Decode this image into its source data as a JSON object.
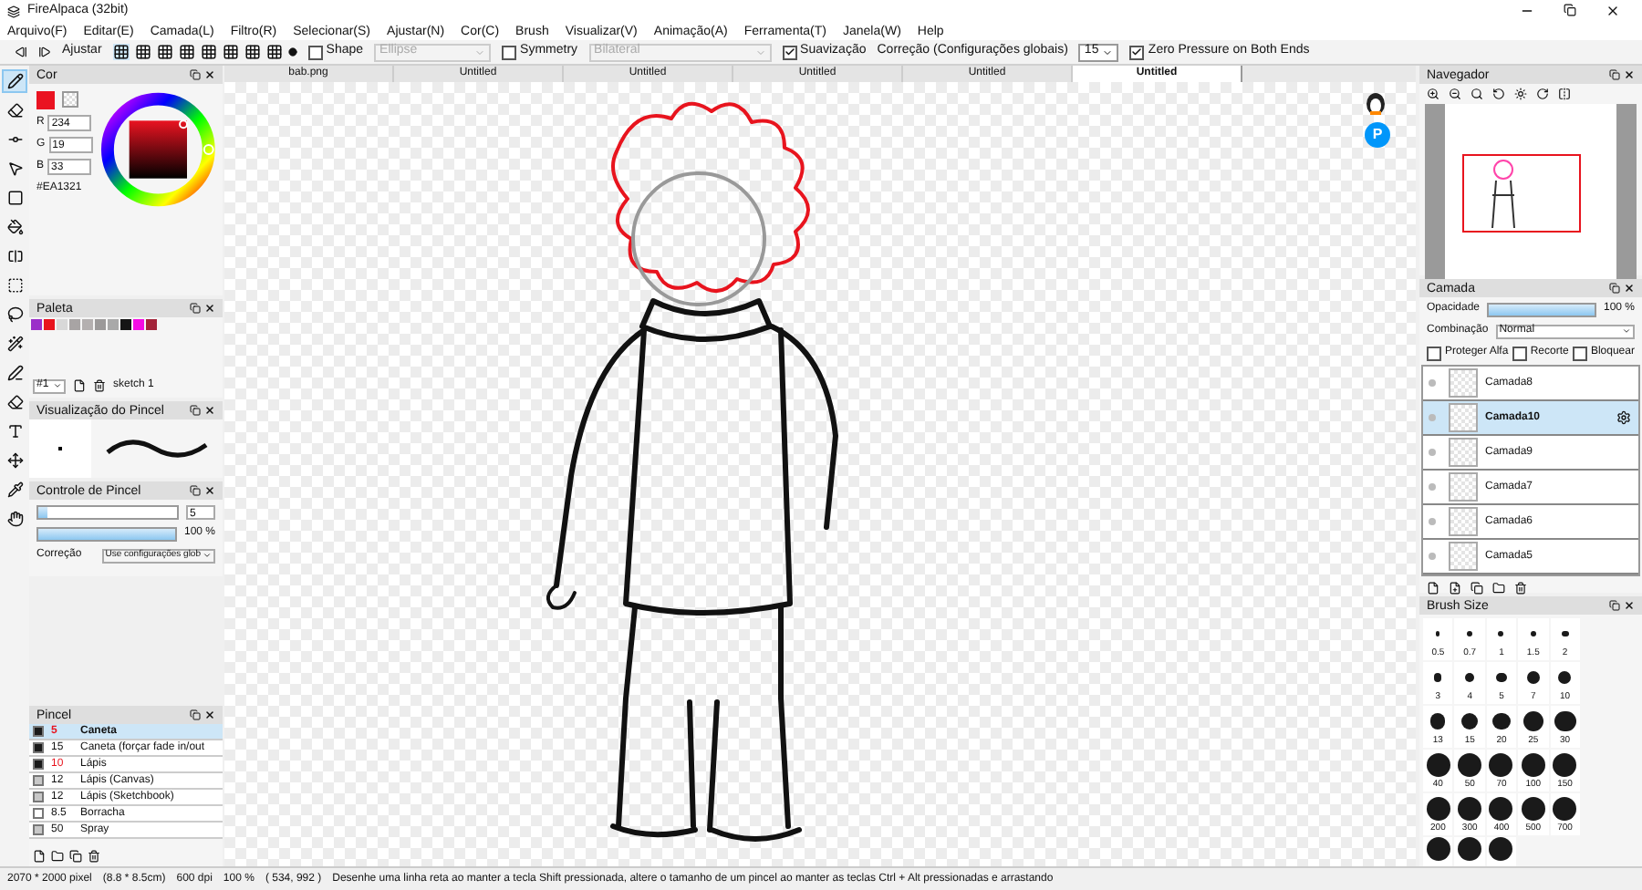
{
  "window": {
    "title": "FireAlpaca (32bit)"
  },
  "menu": [
    "Arquivo(F)",
    "Editar(E)",
    "Camada(L)",
    "Filtro(R)",
    "Selecionar(S)",
    "Ajustar(N)",
    "Cor(C)",
    "Brush",
    "Visualizar(V)",
    "Animação(A)",
    "Ferramenta(T)",
    "Janela(W)",
    "Help"
  ],
  "toolbar": {
    "snap_label": "Ajustar",
    "shape": {
      "label": "Shape",
      "checked": false,
      "value": "Ellipse"
    },
    "symmetry": {
      "label": "Symmetry",
      "checked": false,
      "value": "Bilateral"
    },
    "smoothing": {
      "label": "Suavização",
      "checked": true
    },
    "correction": {
      "label": "Correção (Configurações globais)",
      "value": "15"
    },
    "zero_pressure": {
      "label": "Zero Pressure on Both Ends",
      "checked": true
    }
  },
  "tools": [
    {
      "kind": "pen",
      "selected": true
    },
    {
      "kind": "eraser",
      "selected": false
    },
    {
      "kind": "dots",
      "selected": false
    },
    {
      "kind": "move",
      "selected": false
    },
    {
      "kind": "fill",
      "selected": false
    },
    {
      "kind": "bucket",
      "selected": false
    },
    {
      "kind": "gradient",
      "selected": false
    },
    {
      "kind": "select",
      "selected": false
    },
    {
      "kind": "lasso",
      "selected": false
    },
    {
      "kind": "wand",
      "selected": false
    },
    {
      "kind": "selpen",
      "selected": false
    },
    {
      "kind": "selerase",
      "selected": false
    },
    {
      "kind": "text",
      "selected": false
    },
    {
      "kind": "operation",
      "selected": false
    },
    {
      "kind": "dropper",
      "selected": false
    },
    {
      "kind": "hand",
      "selected": false
    }
  ],
  "color_panel": {
    "title": "Cor",
    "color": "#ea1321",
    "channels": [
      {
        "label": "R",
        "value": "234"
      },
      {
        "label": "G",
        "value": "19"
      },
      {
        "label": "B",
        "value": "33"
      }
    ],
    "hex": "#EA1321"
  },
  "palette": {
    "title": "Paleta",
    "swatches": [
      {
        "color": "#9b2fc9"
      },
      {
        "color": "#e8141e"
      },
      {
        "color": "#d8d8d8"
      },
      {
        "color": "#a8a4a4"
      },
      {
        "color": "#b4b0b0"
      },
      {
        "color": "#9c9a9a"
      },
      {
        "color": "#a9a9a9"
      },
      {
        "color": "#151515"
      },
      {
        "color": "#f40ce4"
      },
      {
        "color": "#a3243a"
      }
    ],
    "set": "#1",
    "name": "sketch 1"
  },
  "brush_preview": {
    "title": "Visualização do Pincel"
  },
  "brush_control": {
    "title": "Controle de Pincel",
    "size": {
      "level": 0.06,
      "value": "5"
    },
    "opacity": {
      "level": 1,
      "value": "100 %"
    },
    "correction_label": "Correção",
    "correction_value": "Use configurações glob"
  },
  "brushes": {
    "title": "Pincel",
    "items": [
      {
        "size": "5",
        "name": "Caneta",
        "selected": true,
        "emphasized": true,
        "color": "#1a1a1a"
      },
      {
        "size": "15",
        "name": "Caneta (forçar fade in/out",
        "selected": false,
        "emphasized": false,
        "color": "#1a1a1a"
      },
      {
        "size": "10",
        "name": "Lápis",
        "selected": false,
        "emphasized": true,
        "color": "#1a1a1a"
      },
      {
        "size": "12",
        "name": "Lápis (Canvas)",
        "selected": false,
        "emphasized": false,
        "color": "#c8c8c8"
      },
      {
        "size": "12",
        "name": "Lápis (Sketchbook)",
        "selected": false,
        "emphasized": false,
        "color": "#c8c8c8"
      },
      {
        "size": "8.5",
        "name": "Borracha",
        "selected": false,
        "emphasized": false,
        "color": "#ffffff"
      },
      {
        "size": "50",
        "name": "Spray",
        "selected": false,
        "emphasized": false,
        "color": "#c8c8c8"
      }
    ]
  },
  "tabs": [
    {
      "label": "bab.png",
      "selected": false
    },
    {
      "label": "Untitled",
      "selected": false
    },
    {
      "label": "Untitled",
      "selected": false
    },
    {
      "label": "Untitled",
      "selected": false
    },
    {
      "label": "Untitled",
      "selected": false
    },
    {
      "label": "Untitled",
      "selected": true
    }
  ],
  "canvas": {
    "badge": "P"
  },
  "navigator": {
    "title": "Navegador"
  },
  "layers": {
    "title": "Camada",
    "opacity_label": "Opacidade",
    "opacity": {
      "level": 1,
      "value": "100 %"
    },
    "blend_label": "Combinação",
    "blend": "Normal",
    "options": [
      {
        "label": "Proteger Alfa",
        "checked": false
      },
      {
        "label": "Recorte",
        "checked": false
      },
      {
        "label": "Bloquear",
        "checked": false
      }
    ],
    "items": [
      {
        "name": "Camada8",
        "selected": false
      },
      {
        "name": "Camada10",
        "selected": true
      },
      {
        "name": "Camada9",
        "selected": false
      },
      {
        "name": "Camada7",
        "selected": false
      },
      {
        "name": "Camada6",
        "selected": false
      },
      {
        "name": "Camada5",
        "selected": false
      }
    ]
  },
  "brush_size": {
    "title": "Brush Size",
    "sizes": [
      "0.5",
      "0.7",
      "1",
      "1.5",
      "2",
      "3",
      "4",
      "5",
      "7",
      "10",
      "13",
      "15",
      "20",
      "25",
      "30",
      "40",
      "50",
      "70",
      "100",
      "150",
      "200",
      "300",
      "400",
      "500",
      "700"
    ],
    "partial_row": [
      {
        "kind": "dot"
      },
      {
        "kind": "dot"
      },
      {
        "kind": "dot"
      }
    ]
  },
  "status_bar": [
    "2070 * 2000 pixel",
    "(8.8 * 8.5cm)",
    "600 dpi",
    "100 %",
    "( 534, 992 )",
    "Desenhe uma linha reta ao manter a tecla Shift pressionada, altere o tamanho de um pincel ao manter as teclas Ctrl + Alt pressionadas e arrastando"
  ]
}
